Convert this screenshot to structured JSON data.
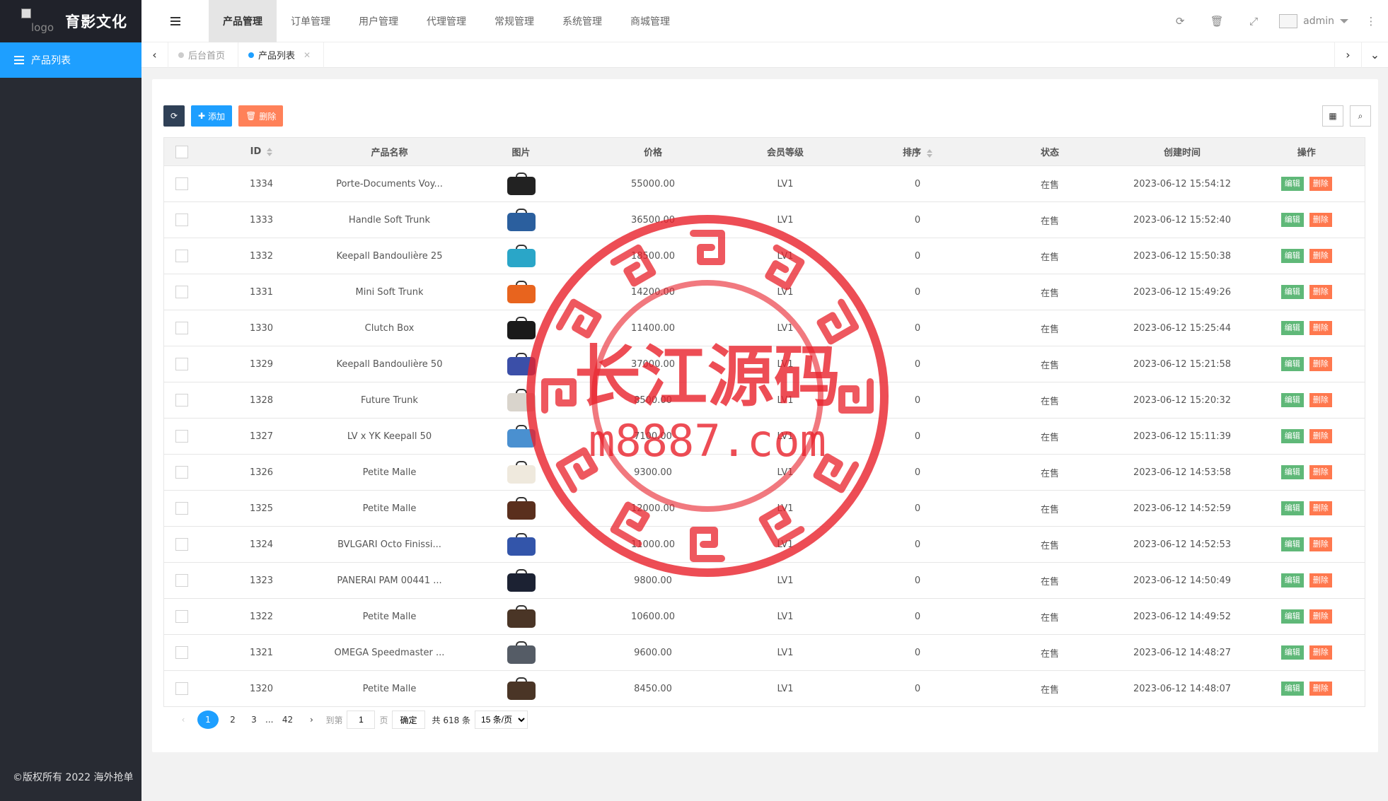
{
  "sidebar": {
    "logo_alt": "logo",
    "brand": "育影文化",
    "menu": [
      {
        "label": "产品列表",
        "icon": "list-icon"
      }
    ],
    "copyright": "©版权所有 2022 海外抢单"
  },
  "header": {
    "nav": [
      "产品管理",
      "订单管理",
      "用户管理",
      "代理管理",
      "常规管理",
      "系统管理",
      "商城管理"
    ],
    "active_nav": 0,
    "user": "admin"
  },
  "tabs": [
    {
      "label": "后台首页",
      "active": false
    },
    {
      "label": "产品列表",
      "active": true
    }
  ],
  "toolbar": {
    "add_label": "添加",
    "delete_label": "删除"
  },
  "table": {
    "headers": [
      "ID",
      "产品名称",
      "图片",
      "价格",
      "会员等级",
      "排序",
      "状态",
      "创建时间",
      "操作"
    ],
    "edit_label": "编辑",
    "delete_label": "删除",
    "rows": [
      {
        "id": "1334",
        "name": "Porte-Documents Voy...",
        "price": "55000.00",
        "level": "LV1",
        "sort": "0",
        "status": "在售",
        "created": "2023-06-12 15:54:12",
        "thumb": "#222222"
      },
      {
        "id": "1333",
        "name": "Handle Soft Trunk",
        "price": "36500.00",
        "level": "LV1",
        "sort": "0",
        "status": "在售",
        "created": "2023-06-12 15:52:40",
        "thumb": "#2b5f9e"
      },
      {
        "id": "1332",
        "name": "Keepall Bandoulière 25",
        "price": "18500.00",
        "level": "LV1",
        "sort": "0",
        "status": "在售",
        "created": "2023-06-12 15:50:38",
        "thumb": "#2aa6c8"
      },
      {
        "id": "1331",
        "name": "Mini Soft Trunk",
        "price": "14200.00",
        "level": "LV1",
        "sort": "0",
        "status": "在售",
        "created": "2023-06-12 15:49:26",
        "thumb": "#e8641e"
      },
      {
        "id": "1330",
        "name": "Clutch Box",
        "price": "11400.00",
        "level": "LV1",
        "sort": "0",
        "status": "在售",
        "created": "2023-06-12 15:25:44",
        "thumb": "#1a1a1a"
      },
      {
        "id": "1329",
        "name": "Keepall Bandoulière 50",
        "price": "37000.00",
        "level": "LV1",
        "sort": "0",
        "status": "在售",
        "created": "2023-06-12 15:21:58",
        "thumb": "#3b4fa8"
      },
      {
        "id": "1328",
        "name": "Future Trunk",
        "price": "8500.00",
        "level": "LV1",
        "sort": "0",
        "status": "在售",
        "created": "2023-06-12 15:20:32",
        "thumb": "#d9d4cc"
      },
      {
        "id": "1327",
        "name": "LV x YK Keepall 50",
        "price": "7100.00",
        "level": "LV1",
        "sort": "0",
        "status": "在售",
        "created": "2023-06-12 15:11:39",
        "thumb": "#4a90d0"
      },
      {
        "id": "1326",
        "name": "Petite Malle",
        "price": "9300.00",
        "level": "LV1",
        "sort": "0",
        "status": "在售",
        "created": "2023-06-12 14:53:58",
        "thumb": "#efe9dd"
      },
      {
        "id": "1325",
        "name": "Petite Malle",
        "price": "12000.00",
        "level": "LV1",
        "sort": "0",
        "status": "在售",
        "created": "2023-06-12 14:52:59",
        "thumb": "#5a2f1d"
      },
      {
        "id": "1324",
        "name": "BVLGARI Octo Finissi...",
        "price": "11000.00",
        "level": "LV1",
        "sort": "0",
        "status": "在售",
        "created": "2023-06-12 14:52:53",
        "thumb": "#3355aa"
      },
      {
        "id": "1323",
        "name": "PANERAI PAM 00441 ...",
        "price": "9800.00",
        "level": "LV1",
        "sort": "0",
        "status": "在售",
        "created": "2023-06-12 14:50:49",
        "thumb": "#1c2233"
      },
      {
        "id": "1322",
        "name": "Petite Malle",
        "price": "10600.00",
        "level": "LV1",
        "sort": "0",
        "status": "在售",
        "created": "2023-06-12 14:49:52",
        "thumb": "#4a3526"
      },
      {
        "id": "1321",
        "name": "OMEGA Speedmaster ...",
        "price": "9600.00",
        "level": "LV1",
        "sort": "0",
        "status": "在售",
        "created": "2023-06-12 14:48:27",
        "thumb": "#555c66"
      },
      {
        "id": "1320",
        "name": "Petite Malle",
        "price": "8450.00",
        "level": "LV1",
        "sort": "0",
        "status": "在售",
        "created": "2023-06-12 14:48:07",
        "thumb": "#4a3526"
      }
    ]
  },
  "pagination": {
    "pages": [
      "1",
      "2",
      "3"
    ],
    "ellipsis": "...",
    "last": "42",
    "goto_label": "到第",
    "goto_value": "1",
    "page_unit": "页",
    "confirm": "确定",
    "total": "共 618 条",
    "page_size": "15 条/页"
  },
  "watermark": {
    "title": "长江源码",
    "url": "m8887.com",
    "color": "#e8202a"
  }
}
